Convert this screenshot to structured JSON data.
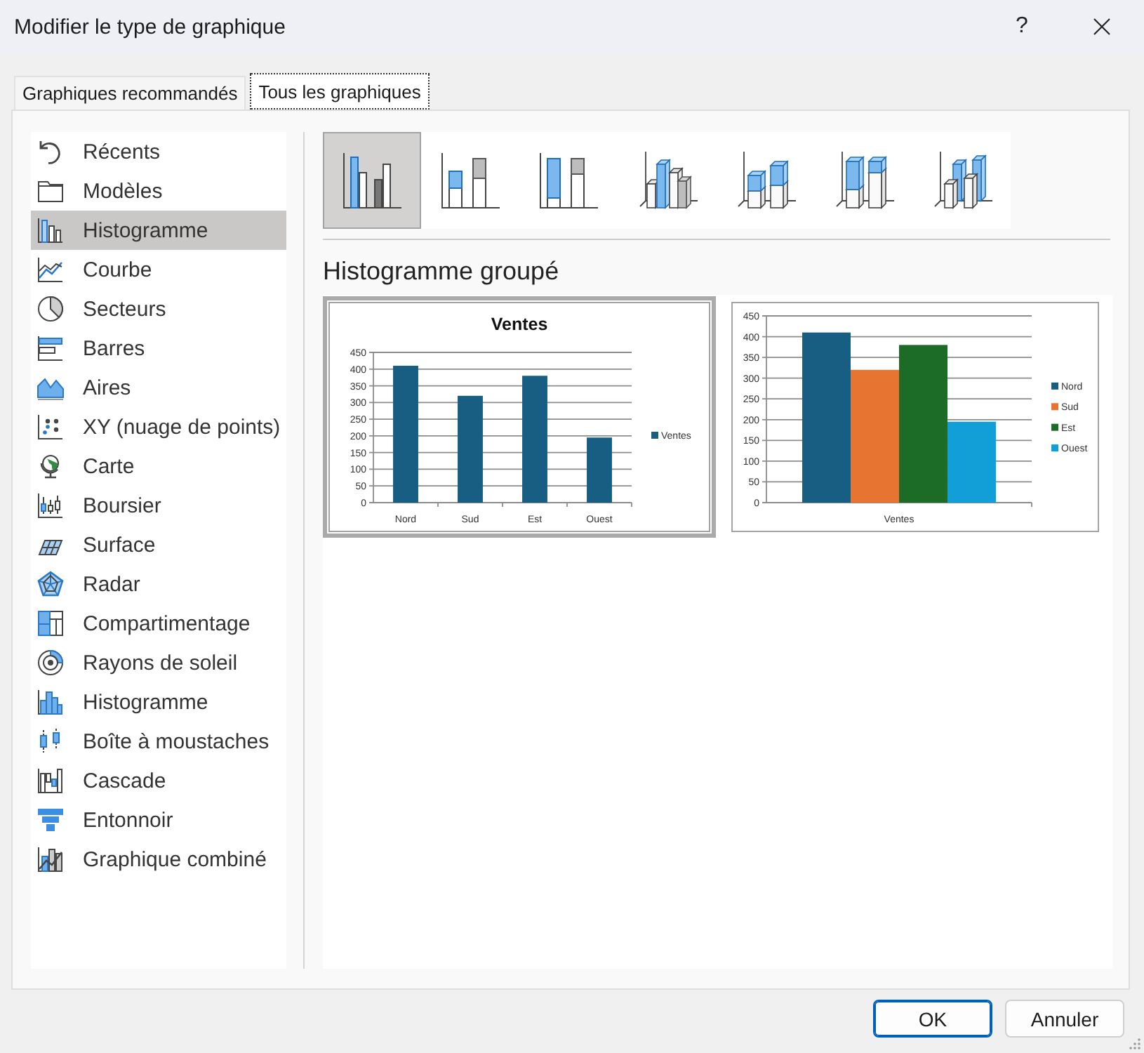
{
  "window": {
    "title": "Modifier le type de graphique",
    "help": "?"
  },
  "tabs": [
    {
      "label": "Graphiques recommandés",
      "selected": false
    },
    {
      "label": "Tous les graphiques",
      "selected": true
    }
  ],
  "categories": [
    {
      "kind": "recent",
      "label": "Récents",
      "selected": false
    },
    {
      "kind": "templates",
      "label": "Modèles",
      "selected": false
    },
    {
      "kind": "column",
      "label": "Histogramme",
      "selected": true
    },
    {
      "kind": "line",
      "label": "Courbe",
      "selected": false
    },
    {
      "kind": "pie",
      "label": "Secteurs",
      "selected": false
    },
    {
      "kind": "bar",
      "label": "Barres",
      "selected": false
    },
    {
      "kind": "area",
      "label": "Aires",
      "selected": false
    },
    {
      "kind": "scatter",
      "label": "XY (nuage de points)",
      "selected": false
    },
    {
      "kind": "map",
      "label": "Carte",
      "selected": false
    },
    {
      "kind": "stock",
      "label": "Boursier",
      "selected": false
    },
    {
      "kind": "surface",
      "label": "Surface",
      "selected": false
    },
    {
      "kind": "radar",
      "label": "Radar",
      "selected": false
    },
    {
      "kind": "treemap",
      "label": "Compartimentage",
      "selected": false
    },
    {
      "kind": "sunburst",
      "label": "Rayons de soleil",
      "selected": false
    },
    {
      "kind": "histogram",
      "label": "Histogramme",
      "selected": false
    },
    {
      "kind": "boxwhisker",
      "label": "Boîte à moustaches",
      "selected": false
    },
    {
      "kind": "waterfall",
      "label": "Cascade",
      "selected": false
    },
    {
      "kind": "funnel",
      "label": "Entonnoir",
      "selected": false
    },
    {
      "kind": "combo",
      "label": "Graphique combiné",
      "selected": false
    }
  ],
  "subtypes": [
    {
      "kind": "clustered",
      "selected": true
    },
    {
      "kind": "stacked",
      "selected": false
    },
    {
      "kind": "full",
      "selected": false
    },
    {
      "kind": "clustered3d",
      "selected": false
    },
    {
      "kind": "stacked3d",
      "selected": false
    },
    {
      "kind": "full3d",
      "selected": false
    },
    {
      "kind": "column3d",
      "selected": false
    }
  ],
  "subtype_title": "Histogramme groupé",
  "previews": [
    {
      "selected": true,
      "chart_data": {
        "type": "bar",
        "title": "Ventes",
        "categories": [
          "Nord",
          "Sud",
          "Est",
          "Ouest"
        ],
        "series": [
          {
            "name": "Ventes",
            "color": "#175e82",
            "values": [
              410,
              320,
              380,
              195
            ]
          }
        ],
        "ylim": [
          0,
          450
        ],
        "yticks": [
          0,
          50,
          100,
          150,
          200,
          250,
          300,
          350,
          400,
          450
        ],
        "grid": true,
        "legend": "right"
      }
    },
    {
      "selected": false,
      "chart_data": {
        "type": "bar",
        "categories": [
          "Ventes"
        ],
        "series": [
          {
            "name": "Nord",
            "color": "#175e82",
            "values": [
              410
            ]
          },
          {
            "name": "Sud",
            "color": "#e87431",
            "values": [
              320
            ]
          },
          {
            "name": "Est",
            "color": "#1c6b27",
            "values": [
              380
            ]
          },
          {
            "name": "Ouest",
            "color": "#129fd8",
            "values": [
              195
            ]
          }
        ],
        "ylim": [
          0,
          450
        ],
        "yticks": [
          0,
          50,
          100,
          150,
          200,
          250,
          300,
          350,
          400,
          450
        ],
        "grid": true,
        "legend": "right"
      }
    }
  ],
  "buttons": [
    {
      "label": "OK",
      "default": true
    },
    {
      "label": "Annuler",
      "default": false
    }
  ]
}
